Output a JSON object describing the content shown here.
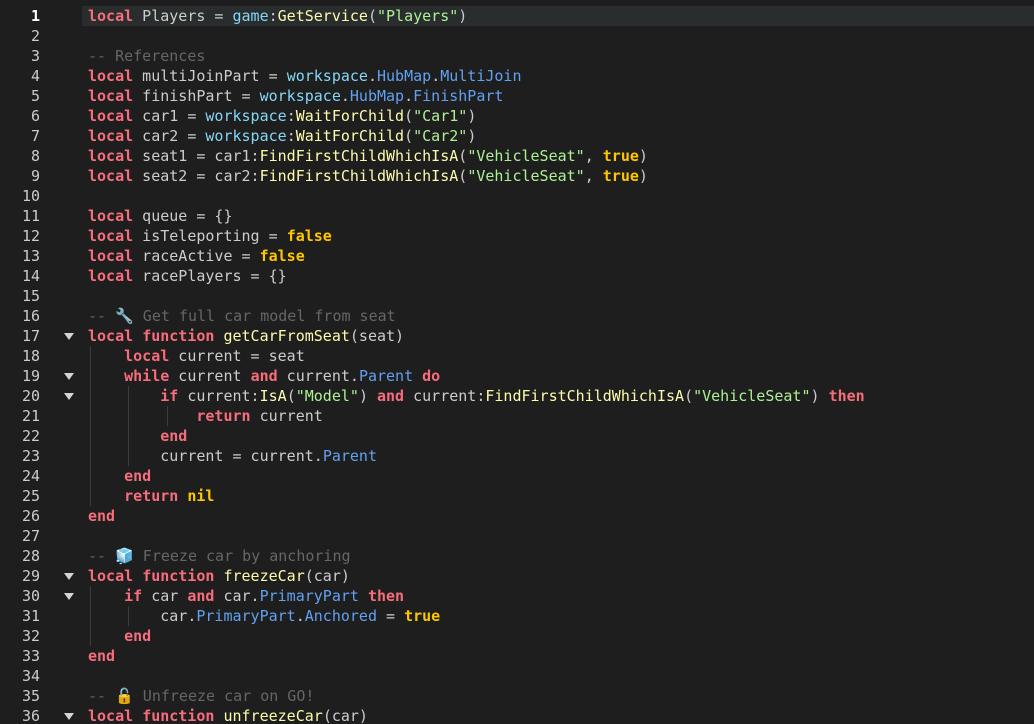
{
  "editor": {
    "current_line": 1,
    "lines": [
      {
        "n": "1",
        "segments": [
          [
            "kw",
            "local"
          ],
          [
            "tx",
            " Players = "
          ],
          [
            "svc",
            "game"
          ],
          [
            "tx",
            ":"
          ],
          [
            "fn",
            "GetService"
          ],
          [
            "tx",
            "("
          ],
          [
            "str",
            "\"Players\""
          ],
          [
            "tx",
            ")"
          ]
        ]
      },
      {
        "n": "2",
        "segments": []
      },
      {
        "n": "3",
        "segments": [
          [
            "cm",
            "-- References"
          ]
        ]
      },
      {
        "n": "4",
        "segments": [
          [
            "kw",
            "local"
          ],
          [
            "tx",
            " multiJoinPart = "
          ],
          [
            "svc",
            "workspace"
          ],
          [
            "tx",
            "."
          ],
          [
            "prop",
            "HubMap"
          ],
          [
            "tx",
            "."
          ],
          [
            "prop",
            "MultiJoin"
          ]
        ]
      },
      {
        "n": "5",
        "segments": [
          [
            "kw",
            "local"
          ],
          [
            "tx",
            " finishPart = "
          ],
          [
            "svc",
            "workspace"
          ],
          [
            "tx",
            "."
          ],
          [
            "prop",
            "HubMap"
          ],
          [
            "tx",
            "."
          ],
          [
            "prop",
            "FinishPart"
          ]
        ]
      },
      {
        "n": "6",
        "segments": [
          [
            "kw",
            "local"
          ],
          [
            "tx",
            " car1 = "
          ],
          [
            "svc",
            "workspace"
          ],
          [
            "tx",
            ":"
          ],
          [
            "fn",
            "WaitForChild"
          ],
          [
            "tx",
            "("
          ],
          [
            "str",
            "\"Car1\""
          ],
          [
            "tx",
            ")"
          ]
        ]
      },
      {
        "n": "7",
        "segments": [
          [
            "kw",
            "local"
          ],
          [
            "tx",
            " car2 = "
          ],
          [
            "svc",
            "workspace"
          ],
          [
            "tx",
            ":"
          ],
          [
            "fn",
            "WaitForChild"
          ],
          [
            "tx",
            "("
          ],
          [
            "str",
            "\"Car2\""
          ],
          [
            "tx",
            ")"
          ]
        ]
      },
      {
        "n": "8",
        "segments": [
          [
            "kw",
            "local"
          ],
          [
            "tx",
            " seat1 = car1:"
          ],
          [
            "fn",
            "FindFirstChildWhichIsA"
          ],
          [
            "tx",
            "("
          ],
          [
            "str",
            "\"VehicleSeat\""
          ],
          [
            "tx",
            ", "
          ],
          [
            "lit",
            "true"
          ],
          [
            "tx",
            ")"
          ]
        ]
      },
      {
        "n": "9",
        "segments": [
          [
            "kw",
            "local"
          ],
          [
            "tx",
            " seat2 = car2:"
          ],
          [
            "fn",
            "FindFirstChildWhichIsA"
          ],
          [
            "tx",
            "("
          ],
          [
            "str",
            "\"VehicleSeat\""
          ],
          [
            "tx",
            ", "
          ],
          [
            "lit",
            "true"
          ],
          [
            "tx",
            ")"
          ]
        ]
      },
      {
        "n": "10",
        "segments": []
      },
      {
        "n": "11",
        "segments": [
          [
            "kw",
            "local"
          ],
          [
            "tx",
            " queue = {}"
          ]
        ]
      },
      {
        "n": "12",
        "segments": [
          [
            "kw",
            "local"
          ],
          [
            "tx",
            " isTeleporting = "
          ],
          [
            "lit",
            "false"
          ]
        ]
      },
      {
        "n": "13",
        "segments": [
          [
            "kw",
            "local"
          ],
          [
            "tx",
            " raceActive = "
          ],
          [
            "lit",
            "false"
          ]
        ]
      },
      {
        "n": "14",
        "segments": [
          [
            "kw",
            "local"
          ],
          [
            "tx",
            " racePlayers = {}"
          ]
        ]
      },
      {
        "n": "15",
        "segments": []
      },
      {
        "n": "16",
        "segments": [
          [
            "cm",
            "-- "
          ],
          [
            "icon",
            "🔧",
            "wrench-icon"
          ],
          [
            "cm",
            " Get full car model from seat"
          ]
        ]
      },
      {
        "n": "17",
        "fold": true,
        "segments": [
          [
            "kw",
            "local"
          ],
          [
            "tx",
            " "
          ],
          [
            "kw",
            "function"
          ],
          [
            "tx",
            " "
          ],
          [
            "fn",
            "getCarFromSeat"
          ],
          [
            "tx",
            "(seat)"
          ]
        ]
      },
      {
        "n": "18",
        "segments": [
          [
            "tx",
            "    "
          ],
          [
            "kw",
            "local"
          ],
          [
            "tx",
            " current = seat"
          ]
        ]
      },
      {
        "n": "19",
        "fold": true,
        "segments": [
          [
            "tx",
            "    "
          ],
          [
            "kw",
            "while"
          ],
          [
            "tx",
            " current "
          ],
          [
            "kw",
            "and"
          ],
          [
            "tx",
            " current."
          ],
          [
            "prop",
            "Parent"
          ],
          [
            "tx",
            " "
          ],
          [
            "kw",
            "do"
          ]
        ]
      },
      {
        "n": "20",
        "fold": true,
        "segments": [
          [
            "tx",
            "        "
          ],
          [
            "kw",
            "if"
          ],
          [
            "tx",
            " current:"
          ],
          [
            "fn",
            "IsA"
          ],
          [
            "tx",
            "("
          ],
          [
            "str",
            "\"Model\""
          ],
          [
            "tx",
            ") "
          ],
          [
            "kw",
            "and"
          ],
          [
            "tx",
            " current:"
          ],
          [
            "fn",
            "FindFirstChildWhichIsA"
          ],
          [
            "tx",
            "("
          ],
          [
            "str",
            "\"VehicleSeat\""
          ],
          [
            "tx",
            ") "
          ],
          [
            "kw",
            "then"
          ]
        ]
      },
      {
        "n": "21",
        "segments": [
          [
            "tx",
            "            "
          ],
          [
            "kw",
            "return"
          ],
          [
            "tx",
            " current"
          ]
        ]
      },
      {
        "n": "22",
        "segments": [
          [
            "tx",
            "        "
          ],
          [
            "kw",
            "end"
          ]
        ]
      },
      {
        "n": "23",
        "segments": [
          [
            "tx",
            "        current = current."
          ],
          [
            "prop",
            "Parent"
          ]
        ]
      },
      {
        "n": "24",
        "segments": [
          [
            "tx",
            "    "
          ],
          [
            "kw",
            "end"
          ]
        ]
      },
      {
        "n": "25",
        "segments": [
          [
            "tx",
            "    "
          ],
          [
            "kw",
            "return"
          ],
          [
            "tx",
            " "
          ],
          [
            "lit",
            "nil"
          ]
        ]
      },
      {
        "n": "26",
        "segments": [
          [
            "kw",
            "end"
          ]
        ]
      },
      {
        "n": "27",
        "segments": []
      },
      {
        "n": "28",
        "segments": [
          [
            "cm",
            "-- "
          ],
          [
            "icon",
            "🧊",
            "cube-icon"
          ],
          [
            "cm",
            " Freeze car by anchoring"
          ]
        ]
      },
      {
        "n": "29",
        "fold": true,
        "segments": [
          [
            "kw",
            "local"
          ],
          [
            "tx",
            " "
          ],
          [
            "kw",
            "function"
          ],
          [
            "tx",
            " "
          ],
          [
            "fn",
            "freezeCar"
          ],
          [
            "tx",
            "(car)"
          ]
        ]
      },
      {
        "n": "30",
        "fold": true,
        "segments": [
          [
            "tx",
            "    "
          ],
          [
            "kw",
            "if"
          ],
          [
            "tx",
            " car "
          ],
          [
            "kw",
            "and"
          ],
          [
            "tx",
            " car."
          ],
          [
            "prop",
            "PrimaryPart"
          ],
          [
            "tx",
            " "
          ],
          [
            "kw",
            "then"
          ]
        ]
      },
      {
        "n": "31",
        "segments": [
          [
            "tx",
            "        car."
          ],
          [
            "prop",
            "PrimaryPart"
          ],
          [
            "tx",
            "."
          ],
          [
            "prop",
            "Anchored"
          ],
          [
            "tx",
            " = "
          ],
          [
            "lit",
            "true"
          ]
        ]
      },
      {
        "n": "32",
        "segments": [
          [
            "tx",
            "    "
          ],
          [
            "kw",
            "end"
          ]
        ]
      },
      {
        "n": "33",
        "segments": [
          [
            "kw",
            "end"
          ]
        ]
      },
      {
        "n": "34",
        "segments": []
      },
      {
        "n": "35",
        "segments": [
          [
            "cm",
            "-- "
          ],
          [
            "icon",
            "🔓",
            "lock-icon"
          ],
          [
            "cm",
            " Unfreeze car on GO!"
          ]
        ]
      },
      {
        "n": "36",
        "fold": true,
        "segments": [
          [
            "kw",
            "local"
          ],
          [
            "tx",
            " "
          ],
          [
            "kw",
            "function"
          ],
          [
            "tx",
            " "
          ],
          [
            "fn",
            "unfreezeCar"
          ],
          [
            "tx",
            "(car)"
          ]
        ]
      }
    ]
  },
  "colors": {
    "background": "#1e1e1e",
    "current_line": "#2a2d2e",
    "keyword": "#f86d7c",
    "literal": "#ffc600",
    "function": "#fdfbac",
    "service": "#84d6f7",
    "property": "#61a1f1",
    "string": "#adf195",
    "comment": "#666666",
    "text": "#cccccc"
  }
}
